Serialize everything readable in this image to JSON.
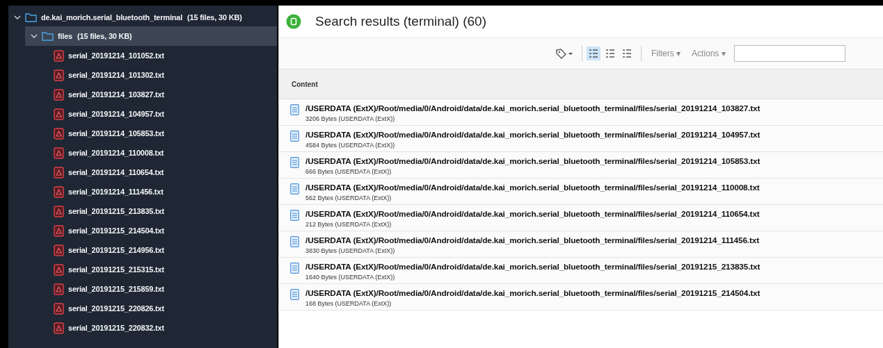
{
  "tree": {
    "root": {
      "name": "de.kai_morich.serial_bluetooth_terminal",
      "info": "(15 files, 30 KB)",
      "expanded": true,
      "selected": false,
      "children": [
        {
          "name": "files",
          "info": "(15 files, 30 KB)",
          "expanded": true,
          "selected": true,
          "children": [
            {
              "name": "serial_20191214_101052.txt"
            },
            {
              "name": "serial_20191214_101302.txt"
            },
            {
              "name": "serial_20191214_103827.txt"
            },
            {
              "name": "serial_20191214_104957.txt"
            },
            {
              "name": "serial_20191214_105853.txt"
            },
            {
              "name": "serial_20191214_110008.txt"
            },
            {
              "name": "serial_20191214_110654.txt"
            },
            {
              "name": "serial_20191214_111456.txt"
            },
            {
              "name": "serial_20191215_213835.txt"
            },
            {
              "name": "serial_20191215_214504.txt"
            },
            {
              "name": "serial_20191215_214956.txt"
            },
            {
              "name": "serial_20191215_215315.txt"
            },
            {
              "name": "serial_20191215_215859.txt"
            },
            {
              "name": "serial_20191215_220826.txt"
            },
            {
              "name": "serial_20191215_220832.txt"
            }
          ]
        }
      ]
    }
  },
  "results": {
    "title": "Search results (terminal) (60)",
    "toolbar": {
      "views": [
        {
          "selected": true
        },
        {
          "selected": false
        },
        {
          "selected": false
        }
      ],
      "filters": "Filters ▾",
      "actions": "Actions ▾"
    },
    "columns": [
      "Content"
    ],
    "rows": [
      {
        "path": "/USERDATA (ExtX)/Root/media/0/Android/data/de.kai_morich.serial_bluetooth_terminal/files/serial_20191214_103827.txt",
        "detail": "3206 Bytes (USERDATA (ExtX))"
      },
      {
        "path": "/USERDATA (ExtX)/Root/media/0/Android/data/de.kai_morich.serial_bluetooth_terminal/files/serial_20191214_104957.txt",
        "detail": "4584 Bytes (USERDATA (ExtX))"
      },
      {
        "path": "/USERDATA (ExtX)/Root/media/0/Android/data/de.kai_morich.serial_bluetooth_terminal/files/serial_20191214_105853.txt",
        "detail": "666 Bytes (USERDATA (ExtX))"
      },
      {
        "path": "/USERDATA (ExtX)/Root/media/0/Android/data/de.kai_morich.serial_bluetooth_terminal/files/serial_20191214_110008.txt",
        "detail": "562 Bytes (USERDATA (ExtX))"
      },
      {
        "path": "/USERDATA (ExtX)/Root/media/0/Android/data/de.kai_morich.serial_bluetooth_terminal/files/serial_20191214_110654.txt",
        "detail": "212 Bytes (USERDATA (ExtX))"
      },
      {
        "path": "/USERDATA (ExtX)/Root/media/0/Android/data/de.kai_morich.serial_bluetooth_terminal/files/serial_20191214_111456.txt",
        "detail": "3830 Bytes (USERDATA (ExtX))"
      },
      {
        "path": "/USERDATA (ExtX)/Root/media/0/Android/data/de.kai_morich.serial_bluetooth_terminal/files/serial_20191215_213835.txt",
        "detail": "1640 Bytes (USERDATA (ExtX))"
      },
      {
        "path": "/USERDATA (ExtX)/Root/media/0/Android/data/de.kai_morich.serial_bluetooth_terminal/files/serial_20191215_214504.txt",
        "detail": "168 Bytes (USERDATA (ExtX))"
      }
    ]
  }
}
